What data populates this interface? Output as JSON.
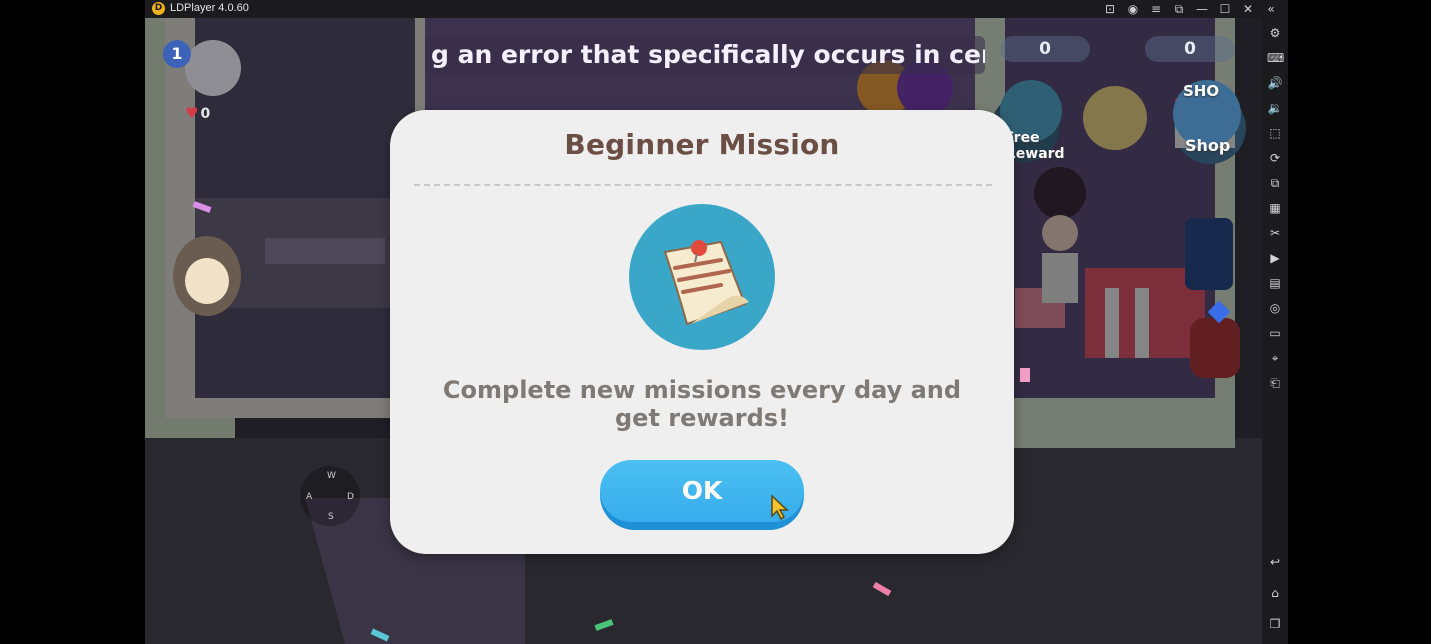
{
  "window": {
    "title": "LDPlayer 4.0.60",
    "logo_letter": "D",
    "controls": [
      {
        "name": "gamepad-icon",
        "glyph": "⊡"
      },
      {
        "name": "account-icon",
        "glyph": "◉"
      },
      {
        "name": "menu-icon",
        "glyph": "≡"
      },
      {
        "name": "pin-icon",
        "glyph": "⧉"
      },
      {
        "name": "minimize-icon",
        "glyph": "—"
      },
      {
        "name": "maximize-icon",
        "glyph": "☐"
      },
      {
        "name": "close-icon",
        "glyph": "✕"
      },
      {
        "name": "collapse-icon",
        "glyph": "«"
      }
    ]
  },
  "sidebar": {
    "tools": [
      {
        "name": "settings-icon",
        "glyph": "⚙"
      },
      {
        "name": "keyboard-icon",
        "glyph": "⌨"
      },
      {
        "name": "volume-up-icon",
        "glyph": "🔊"
      },
      {
        "name": "volume-down-icon",
        "glyph": "🔉"
      },
      {
        "name": "screenshot-icon",
        "glyph": "⬚"
      },
      {
        "name": "rotate-icon",
        "glyph": "⟳"
      },
      {
        "name": "multi-instance-icon",
        "glyph": "⧉"
      },
      {
        "name": "apk-icon",
        "glyph": "▦"
      },
      {
        "name": "scissors-icon",
        "glyph": "✂"
      },
      {
        "name": "record-icon",
        "glyph": "▶"
      },
      {
        "name": "sync-icon",
        "glyph": "▤"
      },
      {
        "name": "operation-icon",
        "glyph": "◎"
      },
      {
        "name": "folder-icon",
        "glyph": "▭"
      },
      {
        "name": "location-icon",
        "glyph": "⌖"
      },
      {
        "name": "shake-icon",
        "glyph": "⎗"
      }
    ],
    "nav": [
      {
        "name": "back-icon",
        "glyph": "↩"
      },
      {
        "name": "home-icon",
        "glyph": "⌂"
      },
      {
        "name": "recents-icon",
        "glyph": "❐"
      }
    ]
  },
  "game": {
    "marquee_text": "g an error that specifically occurs in certain er",
    "counter_left": "0",
    "counter_right": "0",
    "level": "1",
    "hearts": "0",
    "free_reward_label": "Free\nReward",
    "shop_label": "Shop",
    "shop_sign": "SHO",
    "dpad": {
      "up": "W",
      "left": "A",
      "right": "D",
      "down": "S"
    }
  },
  "modal": {
    "title": "Beginner Mission",
    "message": "Complete new missions every day and get rewards!",
    "ok_label": "OK",
    "icon": "mission-note-icon"
  },
  "colors": {
    "modal_title": "#6b4f44",
    "ok_button": "#37acec",
    "mission_icon_bg": "#3aa7c9"
  }
}
